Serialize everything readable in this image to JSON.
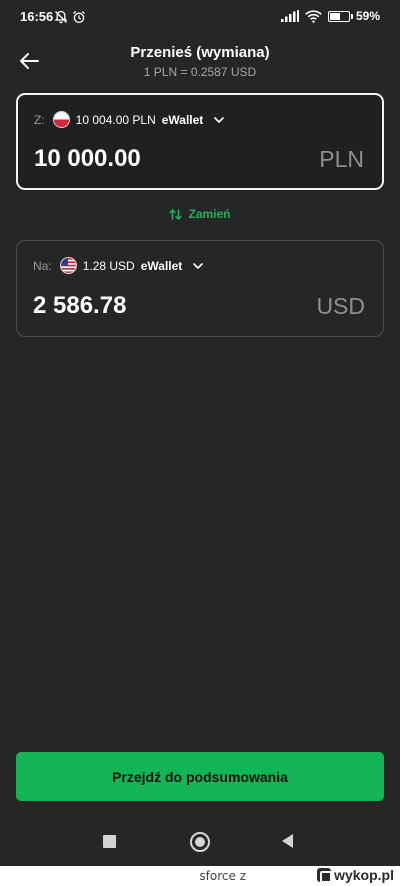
{
  "status_bar": {
    "time": "16:56",
    "battery_text": "59%",
    "battery_level": 0.59,
    "icons": [
      "bell-off-icon",
      "alarm-icon",
      "signal-icon",
      "wifi-icon",
      "battery-icon"
    ]
  },
  "header": {
    "back_icon": "arrow-left-icon",
    "title": "Przenieś (wymiana)",
    "rate": "1 PLN = 0.2587 USD"
  },
  "from_card": {
    "prefix": "Z:",
    "flag": "poland-flag-icon",
    "balance": "10 004.00 PLN",
    "wallet": "eWallet",
    "amount": "10 000.00",
    "currency": "PLN"
  },
  "swap": {
    "icon": "swap-arrows-icon",
    "label": "Zamień",
    "color": "#21b25a"
  },
  "to_card": {
    "prefix": "Na:",
    "flag": "usa-flag-icon",
    "balance": "1.28 USD",
    "wallet": "eWallet",
    "amount": "2 586.78",
    "currency": "USD"
  },
  "cta": {
    "label": "Przejdź do podsumowania",
    "color": "#13b456"
  },
  "nav_bar": {
    "icons": [
      "recents-square-icon",
      "home-circle-icon",
      "back-triangle-icon"
    ]
  },
  "footer": {
    "user": "sforce",
    "separator": "z",
    "brand": "wykop.pl"
  }
}
